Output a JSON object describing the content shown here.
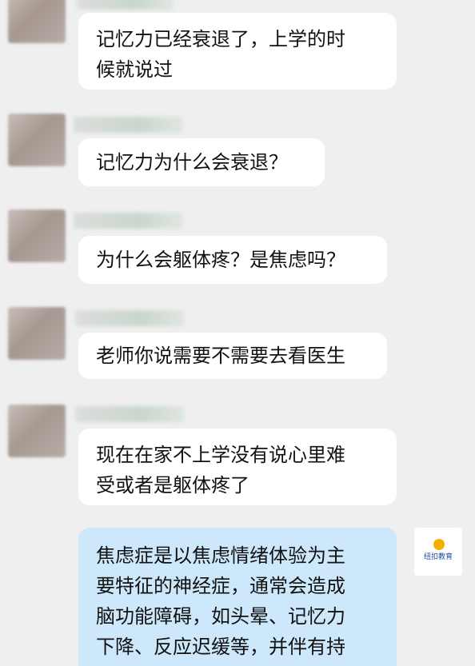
{
  "messages": [
    {
      "text_lines": [
        "记忆力已经衰退了，上学的时",
        "候就说过"
      ]
    },
    {
      "text_lines": [
        "记忆力为什么会衰退？"
      ]
    },
    {
      "text_lines": [
        "为什么会躯体疼？是焦虑吗？"
      ]
    },
    {
      "text_lines": [
        "老师你说需要不需要去看医生"
      ]
    },
    {
      "text_lines": [
        "现在在家不上学没有说心里难",
        "受或者是躯体疼了"
      ]
    }
  ],
  "reply": {
    "text_lines": [
      "焦虑症是以焦虑情绪体验为主",
      "要特征的神经症，通常会造成",
      "脑功能障碍，如头晕、记忆力",
      "下降、反应迟缓等，并伴有持"
    ]
  },
  "self_avatar": {
    "logo_text": "纽扣教育",
    "icon": "sun-logo-icon"
  }
}
